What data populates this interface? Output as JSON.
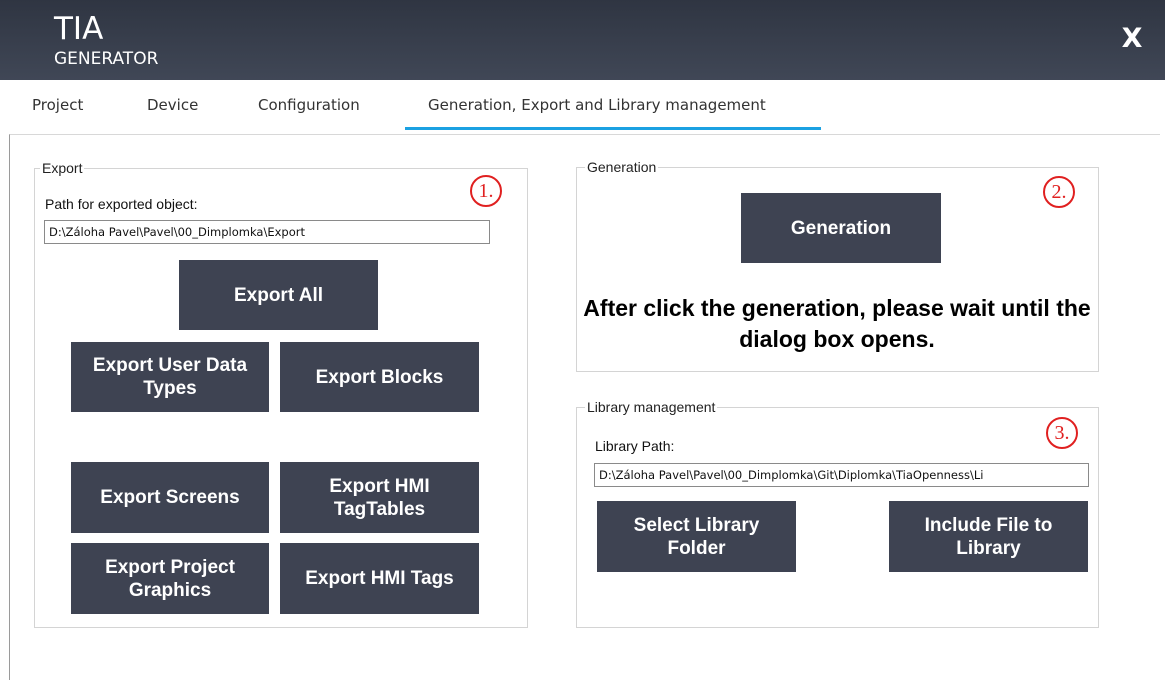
{
  "app": {
    "logo_main": "TIA",
    "logo_sub": "GENERATOR",
    "close_label": "X"
  },
  "tabs": [
    {
      "label": "Project"
    },
    {
      "label": "Device"
    },
    {
      "label": "Configuration"
    },
    {
      "label": "Generation, Export and Library management",
      "active": true
    }
  ],
  "export": {
    "legend": "Export",
    "path_label": "Path for exported object:",
    "path_value": "D:\\Záloha Pavel\\Pavel\\00_Dimplomka\\Export",
    "marker": "1.",
    "buttons": {
      "export_all": "Export All",
      "export_user_data_types": "Export User Data Types",
      "export_blocks": "Export Blocks",
      "export_screens": "Export Screens",
      "export_hmi_tagtables": "Export HMI TagTables",
      "export_project_graphics": "Export Project Graphics",
      "export_hmi_tags": "Export HMI Tags"
    }
  },
  "generation": {
    "legend": "Generation",
    "button": "Generation",
    "marker": "2.",
    "warning": "After click the generation, please wait until the dialog box opens."
  },
  "library": {
    "legend": "Library management",
    "path_label": "Library Path:",
    "path_value": "D:\\Záloha Pavel\\Pavel\\00_Dimplomka\\Git\\Diplomka\\TiaOpenness\\Li",
    "marker": "3.",
    "select_folder": "Select Library Folder",
    "include_file": "Include File to Library"
  },
  "colors": {
    "titlebar": "#363c4a",
    "button": "#3e4352",
    "tab_accent": "#1ba1e2",
    "marker": "#e02020"
  }
}
